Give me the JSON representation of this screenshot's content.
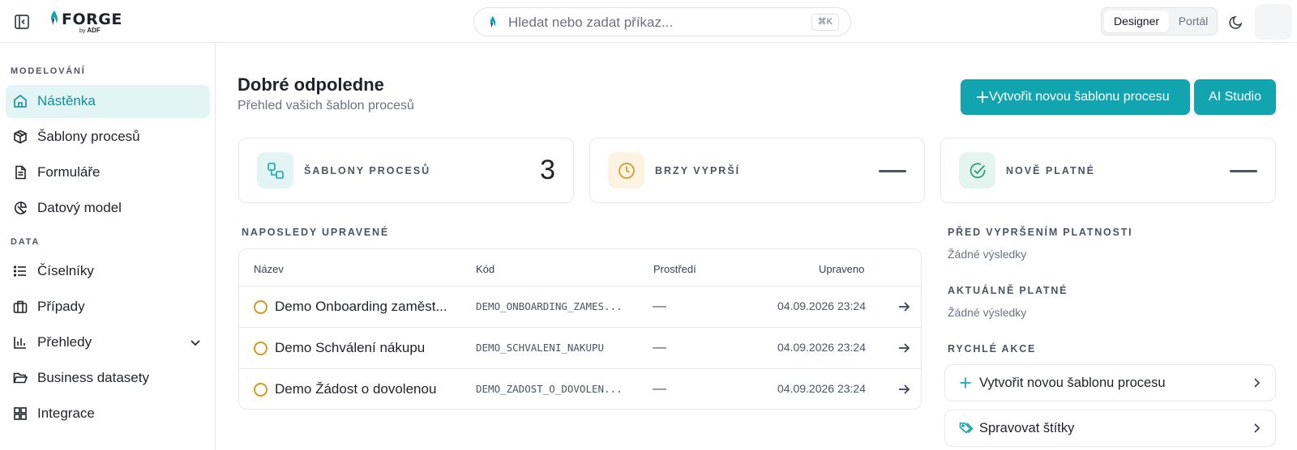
{
  "brand": {
    "name": "FORGE",
    "byline_small": "by",
    "byline": "ADF"
  },
  "search": {
    "placeholder": "Hledat nebo zadat příkaz...",
    "shortcut": "⌘K"
  },
  "mode_switch": {
    "options": [
      "Designer",
      "Portál"
    ],
    "selected": "Designer"
  },
  "sidebar": {
    "sections": [
      {
        "title": "MODELOVÁNÍ",
        "items": [
          {
            "label": "Nástěnka",
            "icon": "home-icon",
            "active": true
          },
          {
            "label": "Šablony procesů",
            "icon": "cube-icon"
          },
          {
            "label": "Formuláře",
            "icon": "document-icon"
          },
          {
            "label": "Datový model",
            "icon": "data-model-icon"
          }
        ]
      },
      {
        "title": "DATA",
        "items": [
          {
            "label": "Číselníky",
            "icon": "list-icon"
          },
          {
            "label": "Případy",
            "icon": "briefcase-icon"
          },
          {
            "label": "Přehledy",
            "icon": "bar-chart-icon",
            "expandable": true
          },
          {
            "label": "Business datasety",
            "icon": "folder-open-icon"
          },
          {
            "label": "Integrace",
            "icon": "grid-icon"
          }
        ]
      }
    ]
  },
  "header": {
    "title": "Dobré odpoledne",
    "subtitle": "Přehled vašich šablon procesů",
    "primary_button": "Vytvořit novou šablonu procesu",
    "ai_button": "AI Studio"
  },
  "stats": [
    {
      "label": "ŠABLONY PROCESŮ",
      "value": "3",
      "icon": "workflow-icon",
      "color": "#12a5b0"
    },
    {
      "label": "BRZY VYPRŠÍ",
      "value": "—",
      "icon": "clock-icon",
      "color": "#d29a1e"
    },
    {
      "label": "NOVĚ PLATNÉ",
      "value": "—",
      "icon": "check-circle-icon",
      "color": "#1f9d74"
    }
  ],
  "recent": {
    "title": "NAPOSLEDY UPRAVENÉ",
    "columns": [
      "Název",
      "Kód",
      "Prostředí",
      "Upraveno"
    ],
    "rows": [
      {
        "name": "Demo Onboarding zaměst...",
        "code": "DEMO_ONBOARDING_ZAMES...",
        "env": "—",
        "updated": "04.09.2026 23:24"
      },
      {
        "name": "Demo Schválení nákupu",
        "code": "DEMO_SCHVALENI_NAKUPU",
        "env": "—",
        "updated": "04.09.2026 23:24"
      },
      {
        "name": "Demo Žádost o dovolenou",
        "code": "DEMO_ZADOST_O_DOVOLEN...",
        "env": "—",
        "updated": "04.09.2026 23:24"
      }
    ]
  },
  "right_panel": {
    "expiring_title": "PŘED VYPRŠENÍM PLATNOSTI",
    "expiring_empty": "Žádné výsledky",
    "valid_title": "AKTUÁLNĚ PLATNÉ",
    "valid_empty": "Žádné výsledky",
    "quick_title": "RYCHLÉ AKCE",
    "quick_actions": [
      {
        "label": "Vytvořit novou šablonu procesu",
        "icon": "plus-icon"
      },
      {
        "label": "Spravovat štítky",
        "icon": "tags-icon"
      }
    ]
  },
  "colors": {
    "accent": "#12a5b0",
    "accent_light": "#e3f4f5",
    "warning": "#d29a1e",
    "success": "#1f9d74"
  }
}
